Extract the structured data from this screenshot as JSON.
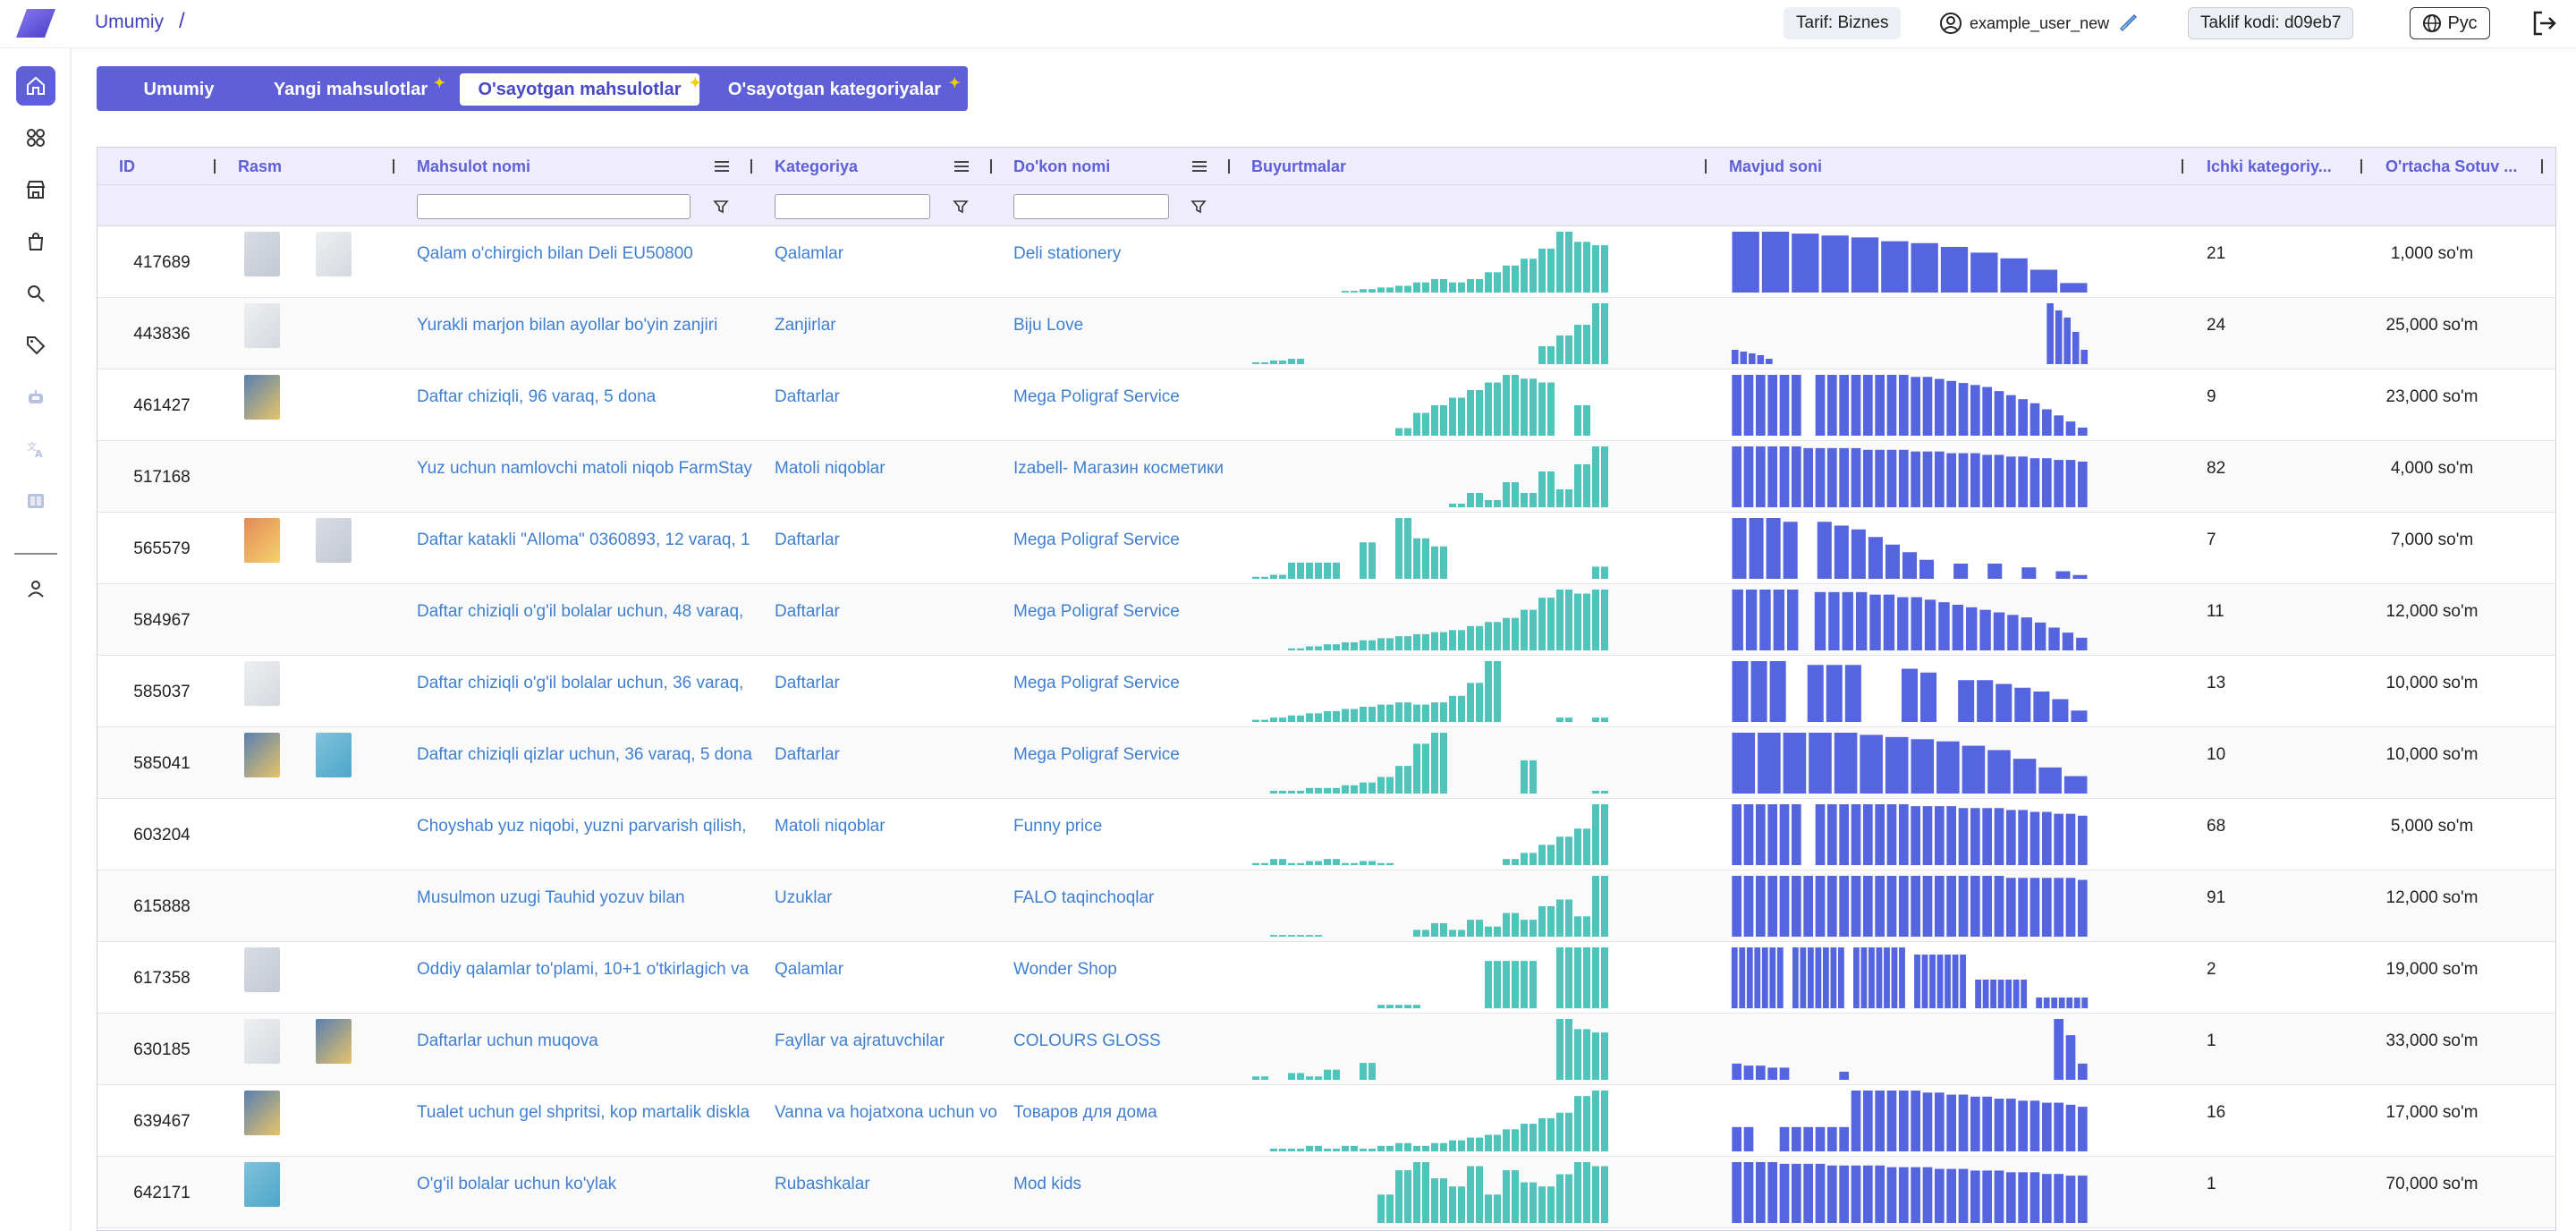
{
  "header": {
    "breadcrumb": "Umumiy",
    "breadcrumb_sep": "/",
    "tariff": "Tarif: Biznes",
    "username": "example_user_new",
    "referral": "Taklif kodi: d09eb7",
    "language": "Рус"
  },
  "tabs": [
    {
      "label": "Umumiy",
      "active": false,
      "new": false
    },
    {
      "label": "Yangi mahsulotlar",
      "active": false,
      "new": true
    },
    {
      "label": "O'sayotgan mahsulotlar",
      "active": true,
      "new": true
    },
    {
      "label": "O'sayotgan kategoriyalar",
      "active": false,
      "new": true
    }
  ],
  "columns": {
    "id": "ID",
    "image": "Rasm",
    "name": "Mahsulot nomi",
    "category": "Kategoriya",
    "shop": "Do'kon nomi",
    "orders": "Buyurtmalar",
    "stock": "Mavjud soni",
    "subcategories": "Ichki kategoriy...",
    "avg_price": "O'rtacha Sotuv ..."
  },
  "colors": {
    "accent": "#5f5fd7",
    "orders_bar": "#4fc4bb",
    "stock_bar": "#5565e0",
    "link": "#3f7fd0"
  },
  "rows": [
    {
      "id": "417689",
      "name": "Qalam o'chirgich bilan Deli EU50800",
      "category": "Qalamlar",
      "shop": "Deli stationery",
      "sub": "21",
      "price": "1,000 so'm",
      "thumbs": 2,
      "orders": [
        0,
        0,
        0,
        0,
        0,
        0,
        0,
        0,
        0,
        0,
        1,
        1,
        2,
        2,
        3,
        3,
        4,
        4,
        6,
        6,
        8,
        8,
        6,
        6,
        8,
        8,
        12,
        12,
        16,
        16,
        20,
        20,
        26,
        26,
        36,
        36,
        30,
        30,
        28,
        28
      ],
      "stock": [
        32,
        32,
        31,
        30,
        29,
        27,
        26,
        24,
        21,
        18,
        12,
        5
      ]
    },
    {
      "id": "443836",
      "name": "Yurakli marjon bilan ayollar bo'yin zanjiri",
      "category": "Zanjirlar",
      "shop": "Biju Love",
      "sub": "24",
      "price": "25,000 so'm",
      "thumbs": 1,
      "orders": [
        1,
        1,
        2,
        2,
        3,
        3,
        0,
        0,
        0,
        0,
        0,
        0,
        0,
        0,
        0,
        0,
        0,
        0,
        0,
        0,
        0,
        0,
        0,
        0,
        0,
        0,
        0,
        0,
        0,
        0,
        0,
        0,
        10,
        10,
        16,
        16,
        22,
        22,
        34,
        34
      ],
      "stock": [
        8,
        7,
        6,
        5,
        3,
        0,
        0,
        0,
        0,
        0,
        0,
        0,
        0,
        0,
        0,
        0,
        0,
        0,
        0,
        0,
        0,
        0,
        0,
        0,
        0,
        0,
        0,
        0,
        0,
        0,
        0,
        0,
        0,
        0,
        0,
        0,
        0,
        34,
        30,
        26,
        18,
        8
      ]
    },
    {
      "id": "461427",
      "name": "Daftar chiziqli, 96 varaq, 5 dona",
      "category": "Daftarlar",
      "shop": "Mega Poligraf Service",
      "sub": "9",
      "price": "23,000 so'm",
      "thumbs": 1,
      "orders": [
        0,
        0,
        0,
        0,
        0,
        0,
        0,
        0,
        0,
        0,
        0,
        0,
        0,
        0,
        0,
        0,
        4,
        4,
        12,
        12,
        16,
        16,
        20,
        20,
        24,
        24,
        28,
        28,
        32,
        32,
        30,
        30,
        28,
        28,
        0,
        0,
        16,
        16,
        0,
        0
      ],
      "stock": [
        30,
        30,
        30,
        30,
        30,
        30,
        0,
        30,
        30,
        30,
        30,
        30,
        30,
        30,
        30,
        29,
        29,
        28,
        27,
        26,
        25,
        24,
        22,
        20,
        18,
        16,
        13,
        10,
        7,
        4
      ]
    },
    {
      "id": "517168",
      "name": "Yuz uchun namlovchi matoli niqob FarmStay",
      "category": "Matoli niqoblar",
      "shop": "Izabell- Магазин косметики",
      "sub": "82",
      "price": "4,000 so'm",
      "thumbs": 0,
      "orders": [
        0,
        0,
        0,
        0,
        0,
        0,
        0,
        0,
        0,
        0,
        0,
        0,
        0,
        0,
        0,
        0,
        0,
        0,
        0,
        0,
        0,
        0,
        2,
        2,
        8,
        8,
        4,
        4,
        14,
        14,
        8,
        8,
        20,
        20,
        10,
        10,
        24,
        24,
        34,
        34
      ],
      "stock": [
        36,
        36,
        36,
        36,
        36,
        36,
        35,
        35,
        35,
        35,
        35,
        34,
        34,
        34,
        34,
        33,
        33,
        33,
        32,
        32,
        32,
        31,
        31,
        30,
        30,
        29,
        29,
        28,
        28,
        27
      ]
    },
    {
      "id": "565579",
      "name": "Daftar katakli \"Alloma\" 0360893, 12 varaq, 1",
      "category": "Daftarlar",
      "shop": "Mega Poligraf Service",
      "sub": "7",
      "price": "7,000 so'm",
      "thumbs": 2,
      "orders": [
        1,
        1,
        2,
        2,
        8,
        8,
        8,
        8,
        8,
        8,
        0,
        0,
        18,
        18,
        0,
        0,
        30,
        30,
        20,
        20,
        16,
        16,
        0,
        0,
        0,
        0,
        0,
        0,
        0,
        0,
        0,
        0,
        0,
        0,
        0,
        0,
        0,
        0,
        6,
        6
      ],
      "stock": [
        32,
        32,
        32,
        30,
        0,
        30,
        28,
        26,
        22,
        18,
        14,
        10,
        0,
        8,
        0,
        8,
        0,
        6,
        0,
        4,
        2
      ]
    },
    {
      "id": "584967",
      "name": "Daftar chiziqli o'g'il bolalar uchun, 48 varaq,",
      "category": "Daftarlar",
      "shop": "Mega Poligraf Service",
      "sub": "11",
      "price": "12,000 so'm",
      "thumbs": 0,
      "orders": [
        0,
        0,
        0,
        0,
        1,
        1,
        2,
        2,
        3,
        3,
        4,
        4,
        5,
        5,
        6,
        6,
        7,
        7,
        8,
        8,
        9,
        9,
        10,
        10,
        12,
        12,
        14,
        14,
        16,
        16,
        20,
        20,
        26,
        26,
        30,
        30,
        28,
        28,
        30,
        30
      ],
      "stock": [
        24,
        24,
        24,
        24,
        24,
        0,
        23,
        23,
        23,
        23,
        22,
        22,
        21,
        21,
        20,
        19,
        18,
        17,
        16,
        15,
        14,
        13,
        11,
        9,
        7,
        5
      ]
    },
    {
      "id": "585037",
      "name": "Daftar chiziqli o'g'il bolalar uchun, 36 varaq,",
      "category": "Daftarlar",
      "shop": "Mega Poligraf Service",
      "sub": "13",
      "price": "10,000 so'm",
      "thumbs": 1,
      "orders": [
        1,
        1,
        2,
        2,
        3,
        3,
        4,
        4,
        5,
        5,
        6,
        6,
        7,
        7,
        8,
        8,
        9,
        9,
        8,
        8,
        9,
        9,
        12,
        12,
        18,
        18,
        28,
        28,
        0,
        0,
        0,
        0,
        0,
        0,
        2,
        2,
        0,
        0,
        2,
        2
      ],
      "stock": [
        32,
        32,
        32,
        0,
        30,
        30,
        30,
        0,
        0,
        28,
        26,
        0,
        22,
        22,
        20,
        18,
        16,
        12,
        6
      ]
    },
    {
      "id": "585041",
      "name": "Daftar chiziqli qizlar uchun, 36 varaq, 5 dona",
      "category": "Daftarlar",
      "shop": "Mega Poligraf Service",
      "sub": "10",
      "price": "10,000 so'm",
      "thumbs": 2,
      "orders": [
        0,
        0,
        1,
        1,
        1,
        1,
        2,
        2,
        2,
        2,
        3,
        3,
        4,
        4,
        6,
        6,
        10,
        10,
        18,
        18,
        22,
        22,
        0,
        0,
        0,
        0,
        0,
        0,
        0,
        0,
        12,
        12,
        0,
        0,
        0,
        0,
        0,
        0,
        1,
        1
      ],
      "stock": [
        28,
        28,
        28,
        28,
        28,
        27,
        26,
        25,
        24,
        22,
        20,
        16,
        12,
        8
      ]
    },
    {
      "id": "603204",
      "name": "Choyshab yuz niqobi, yuzni parvarish qilish,",
      "category": "Matoli niqoblar",
      "shop": "Funny price",
      "sub": "68",
      "price": "5,000 so'm",
      "thumbs": 0,
      "orders": [
        1,
        1,
        3,
        3,
        1,
        1,
        2,
        2,
        3,
        3,
        1,
        1,
        2,
        2,
        1,
        1,
        0,
        0,
        0,
        0,
        0,
        0,
        0,
        0,
        0,
        0,
        0,
        0,
        3,
        3,
        6,
        6,
        10,
        10,
        14,
        14,
        18,
        18,
        30,
        30
      ],
      "stock": [
        32,
        32,
        32,
        32,
        32,
        32,
        0,
        32,
        32,
        32,
        32,
        32,
        32,
        32,
        32,
        31,
        31,
        31,
        31,
        30,
        30,
        30,
        30,
        29,
        29,
        28,
        28,
        27,
        27,
        26
      ]
    },
    {
      "id": "615888",
      "name": "Musulmon uzugi Tauhid yozuv bilan",
      "category": "Uzuklar",
      "shop": "FALO taqinchoqlar",
      "sub": "91",
      "price": "12,000 so'm",
      "thumbs": 0,
      "orders": [
        0,
        0,
        1,
        1,
        1,
        1,
        1,
        1,
        0,
        0,
        0,
        0,
        0,
        0,
        0,
        0,
        0,
        0,
        4,
        4,
        8,
        8,
        4,
        4,
        10,
        10,
        6,
        6,
        14,
        14,
        10,
        10,
        18,
        18,
        22,
        22,
        12,
        12,
        36,
        36
      ],
      "stock": [
        30,
        30,
        30,
        30,
        30,
        30,
        30,
        30,
        30,
        30,
        30,
        30,
        30,
        30,
        30,
        30,
        30,
        30,
        30,
        30,
        30,
        30,
        30,
        29,
        29,
        29,
        29,
        29,
        29,
        28
      ]
    },
    {
      "id": "617358",
      "name": "Oddiy qalamlar to'plami, 10+1 o'tkirlagich va",
      "category": "Qalamlar",
      "shop": "Wonder Shop",
      "sub": "2",
      "price": "19,000 so'm",
      "thumbs": 1,
      "orders": [
        0,
        0,
        0,
        0,
        0,
        0,
        0,
        0,
        0,
        0,
        0,
        0,
        0,
        0,
        1,
        1,
        1,
        1,
        1,
        0,
        0,
        0,
        0,
        0,
        0,
        0,
        14,
        14,
        14,
        14,
        14,
        14,
        0,
        0,
        18,
        18,
        18,
        18,
        18,
        18
      ],
      "stock": [
        34,
        34,
        34,
        34,
        34,
        34,
        34,
        0,
        34,
        34,
        34,
        34,
        34,
        34,
        34,
        0,
        34,
        34,
        34,
        34,
        34,
        34,
        34,
        0,
        30,
        30,
        30,
        30,
        30,
        30,
        30,
        0,
        16,
        16,
        16,
        16,
        16,
        16,
        16,
        0,
        6,
        6,
        6,
        6,
        6,
        6,
        6
      ]
    },
    {
      "id": "630185",
      "name": "Daftarlar uchun muqova",
      "category": "Fayllar va ajratuvchilar",
      "shop": "COLOURS GLOSS",
      "sub": "1",
      "price": "33,000 so'm",
      "thumbs": 2,
      "orders": [
        2,
        2,
        0,
        0,
        4,
        4,
        2,
        2,
        6,
        6,
        0,
        0,
        10,
        10,
        0,
        0,
        0,
        0,
        0,
        0,
        0,
        0,
        0,
        0,
        0,
        0,
        0,
        0,
        0,
        0,
        0,
        0,
        0,
        0,
        36,
        36,
        30,
        30,
        28,
        28
      ],
      "stock": [
        8,
        7,
        7,
        6,
        6,
        0,
        0,
        0,
        0,
        4,
        0,
        0,
        0,
        0,
        0,
        0,
        0,
        0,
        0,
        0,
        0,
        0,
        0,
        0,
        0,
        0,
        0,
        30,
        22,
        8
      ]
    },
    {
      "id": "639467",
      "name": "Tualet uchun gel shpritsi, kop martalik diskla",
      "category": "Vanna va hojatxona uchun vo",
      "shop": "Товаров для дома",
      "sub": "16",
      "price": "17,000 so'm",
      "thumbs": 1,
      "orders": [
        0,
        0,
        1,
        1,
        1,
        1,
        2,
        2,
        1,
        1,
        2,
        2,
        1,
        1,
        2,
        2,
        3,
        3,
        2,
        2,
        3,
        3,
        4,
        4,
        5,
        5,
        6,
        6,
        8,
        8,
        10,
        10,
        12,
        12,
        14,
        14,
        20,
        20,
        22,
        22
      ],
      "stock": [
        12,
        12,
        0,
        0,
        12,
        12,
        12,
        12,
        12,
        12,
        30,
        30,
        30,
        30,
        30,
        30,
        29,
        29,
        28,
        28,
        27,
        27,
        26,
        26,
        25,
        25,
        24,
        24,
        23,
        22
      ]
    },
    {
      "id": "642171",
      "name": "O'g'il bolalar uchun ko'ylak",
      "category": "Rubashkalar",
      "shop": "Mod kids",
      "sub": "1",
      "price": "70,000 so'm",
      "thumbs": 1,
      "orders": [
        0,
        0,
        0,
        0,
        0,
        0,
        0,
        0,
        0,
        0,
        0,
        0,
        0,
        0,
        14,
        14,
        26,
        26,
        30,
        30,
        22,
        22,
        18,
        18,
        28,
        28,
        14,
        14,
        26,
        26,
        20,
        20,
        18,
        18,
        24,
        24,
        30,
        30,
        28,
        28
      ],
      "stock": [
        36,
        36,
        36,
        36,
        35,
        35,
        35,
        35,
        34,
        34,
        34,
        34,
        34,
        33,
        33,
        33,
        33,
        32,
        32,
        32,
        31,
        31,
        31,
        30,
        30,
        30,
        29,
        29,
        28,
        28
      ]
    }
  ]
}
